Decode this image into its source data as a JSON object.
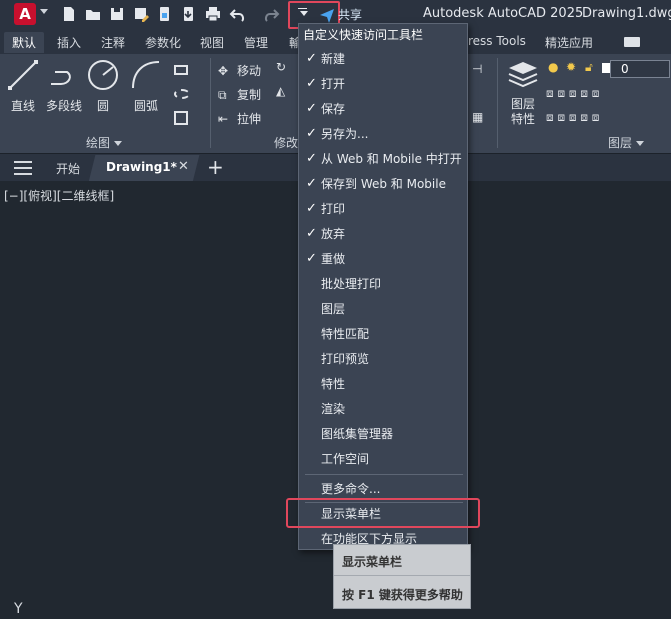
{
  "app": {
    "logo_letter": "A",
    "share_label": "共享",
    "title": "Autodesk AutoCAD 2025",
    "document": "Drawing1.dwg"
  },
  "ribbon_tabs": [
    "默认",
    "插入",
    "注释",
    "参数化",
    "视图",
    "管理",
    "輸",
    "ress Tools",
    "精选应用"
  ],
  "ribbon": {
    "draw_tools": [
      "直线",
      "多段线",
      "圆",
      "圆弧"
    ],
    "draw_panel_title": "绘图",
    "modify_tools": [
      "移动",
      "复制",
      "拉伸"
    ],
    "modify_panel_title": "修改",
    "layer_tool": "图层\n特性",
    "layer_tool_line1": "图层",
    "layer_tool_line2": "特性",
    "layer_panel_title": "图层",
    "layer_value": "0"
  },
  "file_tabs": {
    "start": "开始",
    "active": "Drawing1*",
    "close": "✕",
    "add": "+"
  },
  "viewport": {
    "label": "[−][俯视][二维线框]",
    "ucs_label": "Y"
  },
  "menu": {
    "header": "自定义快速访问工具栏",
    "checked_items": [
      "新建",
      "打开",
      "保存",
      "另存为...",
      "从 Web 和 Mobile 中打开",
      "保存到 Web 和 Mobile",
      "打印",
      "放弃",
      "重做"
    ],
    "unchecked_items": [
      "批处理打印",
      "图层",
      "特性匹配",
      "打印预览",
      "特性",
      "渲染",
      "图纸集管理器",
      "工作空间"
    ],
    "more_commands": "更多命令...",
    "show_menubar": "显示菜单栏",
    "below_ribbon": "在功能区下方显示"
  },
  "tooltip": {
    "title": "显示菜单栏",
    "help": "按 F1 键获得更多帮助"
  },
  "colors": {
    "accent_red": "#e0475c",
    "logo_red": "#c8102e",
    "share_blue": "#4aa3f0"
  }
}
